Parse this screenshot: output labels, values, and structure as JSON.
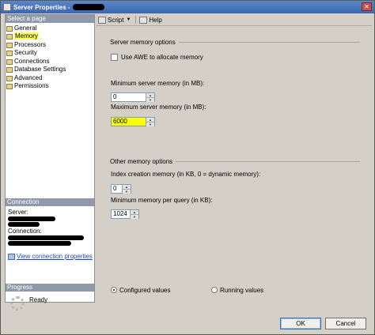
{
  "window": {
    "title": "Server Properties -"
  },
  "left": {
    "select_header": "Select a page",
    "nav": [
      {
        "label": "General"
      },
      {
        "label": "Memory"
      },
      {
        "label": "Processors"
      },
      {
        "label": "Security"
      },
      {
        "label": "Connections"
      },
      {
        "label": "Database Settings"
      },
      {
        "label": "Advanced"
      },
      {
        "label": "Permissions"
      }
    ],
    "connection_header": "Connection",
    "server_label": "Server:",
    "connection_label": "Connection:",
    "view_link": "View connection properties",
    "progress_header": "Progress",
    "progress_status": "Ready"
  },
  "toolbar": {
    "script": "Script",
    "help": "Help"
  },
  "memory": {
    "server_group": "Server memory options",
    "awe_label": "Use AWE to allocate memory",
    "min_label": "Minimum server memory (in MB):",
    "min_value": "0",
    "max_label": "Maximum server memory (in MB):",
    "max_value": "6000",
    "other_group": "Other memory options",
    "index_label": "Index creation memory (in KB, 0 = dynamic memory):",
    "index_value": "0",
    "query_label": "Minimum memory per query (in KB):",
    "query_value": "1024",
    "configured_label": "Configured values",
    "running_label": "Running values"
  },
  "buttons": {
    "ok": "OK",
    "cancel": "Cancel"
  }
}
